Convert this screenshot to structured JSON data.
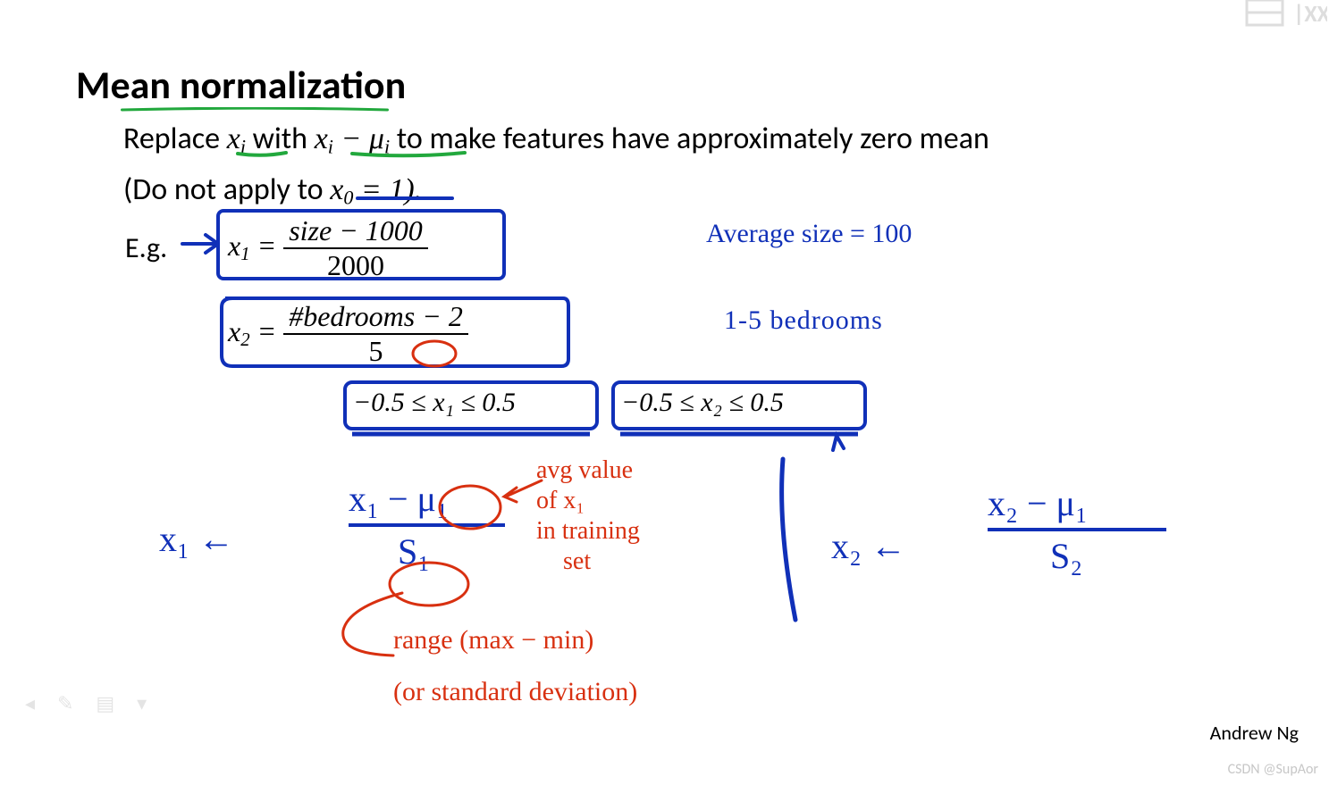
{
  "title": "Mean normalization",
  "body": {
    "line1_pre": "Replace ",
    "line1_x": "x",
    "line1_i": "i",
    "line1_mid": " with ",
    "line1_x2": "x",
    "line1_i2": "i",
    "line1_minus": " − ",
    "line1_mu": "μ",
    "line1_i3": "i",
    "line1_post": " to make features have approximately zero mean",
    "line2_pre": "(Do not apply to ",
    "line2_x": "x",
    "line2_0": "0",
    "line2_eq": " = 1).",
    "eg": "E.g."
  },
  "eq1": {
    "lhs_x": "x",
    "lhs_sub": "1",
    "eq": " = ",
    "num": "size − 1000",
    "den": "2000"
  },
  "eq2": {
    "lhs_x": "x",
    "lhs_sub": "2",
    "eq": " = ",
    "num": "#bedrooms − 2",
    "den": "5"
  },
  "bounds": {
    "b1": "−0.5 ≤ x₁ ≤ 0.5",
    "b2": "−0.5 ≤ x₂ ≤ 0.5"
  },
  "side_notes": {
    "avg_size": "Average   size = 100",
    "bedrooms": "1-5   bedrooms"
  },
  "formula1": {
    "lhs": "x₁  ←",
    "num": "x₁ − μ₁",
    "den": "S₁"
  },
  "formula2": {
    "lhs": "x₂  ←",
    "num": "x₂ − μ₁",
    "den": "S₂"
  },
  "red": {
    "avg_note_l1": "avg value",
    "avg_note_l2": "of x₁",
    "avg_note_l3": "in training",
    "avg_note_l4": "set",
    "range": "range  (max − min)",
    "or_std": "(or standard deviation)"
  },
  "footer": {
    "author": "Andrew Ng",
    "watermark": "CSDN @SupAor"
  },
  "toolbar_placeholder": "◂   ✎   ▤   ▾"
}
